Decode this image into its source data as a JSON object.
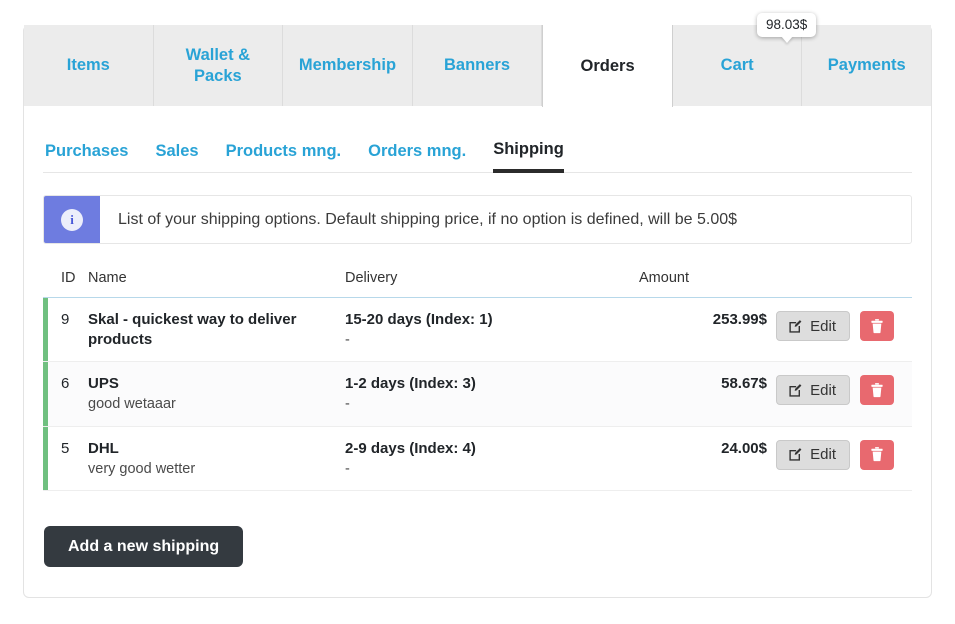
{
  "tabs": [
    {
      "label": "Items",
      "active": false
    },
    {
      "label": "Wallet & Packs",
      "active": false
    },
    {
      "label": "Membership",
      "active": false
    },
    {
      "label": "Banners",
      "active": false
    },
    {
      "label": "Orders",
      "active": true
    },
    {
      "label": "Cart",
      "active": false
    },
    {
      "label": "Payments",
      "active": false
    }
  ],
  "tooltip": {
    "text": "98.03$",
    "anchor_tab": "Cart"
  },
  "subnav": [
    {
      "label": "Purchases",
      "active": false
    },
    {
      "label": "Sales",
      "active": false
    },
    {
      "label": "Products mng.",
      "active": false
    },
    {
      "label": "Orders mng.",
      "active": false
    },
    {
      "label": "Shipping",
      "active": true
    }
  ],
  "alert": {
    "icon": "info-icon",
    "icon_glyph": "i",
    "text": "List of your shipping options. Default shipping price, if no option is defined, will be 5.00$"
  },
  "table": {
    "headers": {
      "id": "ID",
      "name": "Name",
      "delivery": "Delivery",
      "amount": "Amount"
    },
    "rows": [
      {
        "id": "9",
        "name": "Skal - quickest way to deliver products",
        "name_sub": "",
        "delivery": "15-20 days (Index: 1)",
        "delivery_sub": "-",
        "amount": "253.99$",
        "edit_label": "Edit",
        "striped": false
      },
      {
        "id": "6",
        "name": "UPS",
        "name_sub": "good wetaaar",
        "delivery": "1-2 days (Index: 3)",
        "delivery_sub": "-",
        "amount": "58.67$",
        "edit_label": "Edit",
        "striped": true
      },
      {
        "id": "5",
        "name": "DHL",
        "name_sub": "very good wetter",
        "delivery": "2-9 days (Index: 4)",
        "delivery_sub": "-",
        "amount": "24.00$",
        "edit_label": "Edit",
        "striped": false
      }
    ]
  },
  "add_button": {
    "label": "Add a new shipping"
  },
  "colors": {
    "link": "#29a3d6",
    "accent_green": "#70c080",
    "alert_icon_bg": "#6e7ce0",
    "danger": "#e8696f",
    "dark": "#343a40"
  }
}
